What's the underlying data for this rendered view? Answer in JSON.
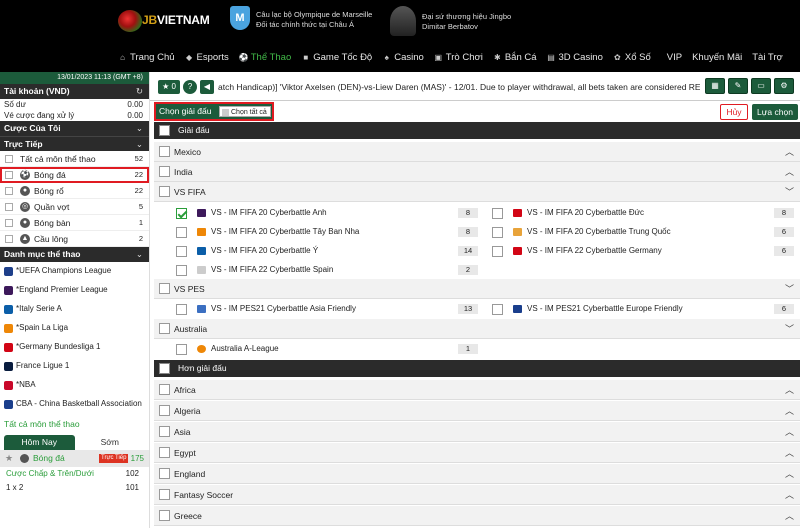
{
  "header": {
    "brand": "VIETNAM",
    "brand_prefix": "JB",
    "partner1": [
      "Câu lạc bộ Olympique de Marseille",
      "Đối tác chính thức tại Châu Á"
    ],
    "partner2": [
      "Đại sứ thương hiệu Jingbo",
      "Dimitar Berbatov"
    ],
    "nav": [
      {
        "label": "Trang Chủ",
        "icon": "home-icon"
      },
      {
        "label": "Esports",
        "icon": "gamepad-icon"
      },
      {
        "label": "Thể Thao",
        "icon": "soccer-ball-icon"
      },
      {
        "label": "Game Tốc Độ",
        "icon": "speed-icon"
      },
      {
        "label": "Casino",
        "icon": "cards-icon"
      },
      {
        "label": "Trò Chơi",
        "icon": "slot-icon"
      },
      {
        "label": "Bắn Cá",
        "icon": "fish-icon"
      },
      {
        "label": "3D Casino",
        "icon": "cube-icon"
      },
      {
        "label": "Xổ Số",
        "icon": "lottery-icon"
      },
      {
        "label": "VIP",
        "icon": ""
      },
      {
        "label": "Khuyến Mãi",
        "icon": ""
      },
      {
        "label": "Tài Trợ",
        "icon": ""
      }
    ]
  },
  "sidebar": {
    "datetime": "13/01/2023 11:13 (GMT +8)",
    "account_title": "Tài khoản (VND)",
    "balance_label": "Số dư",
    "balance_value": "0.00",
    "pending_label": "Vé cược đang xử lý",
    "pending_value": "0.00",
    "my_bets": "Cược Của Tôi",
    "live_title": "Trực Tiếp",
    "sports": [
      {
        "label": "Tất cả môn thể thao",
        "count": "52"
      },
      {
        "label": "Bóng đá",
        "count": "22"
      },
      {
        "label": "Bóng rổ",
        "count": "22"
      },
      {
        "label": "Quần vợt",
        "count": "5"
      },
      {
        "label": "Bóng bàn",
        "count": "1"
      },
      {
        "label": "Cầu lông",
        "count": "2"
      }
    ],
    "category_title": "Danh mục thể thao",
    "leagues": [
      {
        "label": "*UEFA Champions League"
      },
      {
        "label": "*England Premier League"
      },
      {
        "label": "*Italy Serie A"
      },
      {
        "label": "*Spain La Liga"
      },
      {
        "label": "*Germany Bundesliga 1"
      },
      {
        "label": "France Ligue 1"
      },
      {
        "label": "*NBA"
      },
      {
        "label": "CBA - China Basketball Association"
      }
    ],
    "all_sports_link": "Tất cả môn thể thao",
    "tab_today": "Hôm Nay",
    "tab_early": "Sớm",
    "football_label": "Bóng đá",
    "live_badge": "Trực Tiếp",
    "football_count": "175",
    "bet_types": [
      {
        "label": "Cược Chấp & Trên/Dưới",
        "count": "102"
      },
      {
        "label": "1 x 2",
        "count": "101"
      }
    ]
  },
  "toolbar": {
    "fav_count": "0",
    "help": "?",
    "marquee": "atch Handicap)] 'Viktor Axelsen (DEN)-vs-Liew Daren (MAS)' - 12/01. Due to player withdrawal, all bets taken are considered REFUNDE"
  },
  "selector": {
    "title": "Chọn giải đấu",
    "select_all": "Chọn tất cả",
    "cancel": "Hủy",
    "confirm": "Lựa chọn"
  },
  "leagues_group": "Giải đấu",
  "more_group": "Hơn giải đấu",
  "categories": {
    "mexico": "Mexico",
    "india": "India",
    "vs_fifa": "VS FIFA",
    "vs_pes": "VS PES",
    "australia": "Australia"
  },
  "fifa_left": [
    {
      "label": "VS - IM FIFA 20 Cyberbattle Anh",
      "count": "8"
    },
    {
      "label": "VS - IM FIFA 20 Cyberbattle Tây Ban Nha",
      "count": "8"
    },
    {
      "label": "VS - IM FIFA 20 Cyberbattle Ý",
      "count": "14"
    },
    {
      "label": "VS - IM FIFA 22 Cyberbattle Spain",
      "count": "2"
    }
  ],
  "fifa_right": [
    {
      "label": "VS - IM FIFA 20 Cyberbattle Đức",
      "count": "8"
    },
    {
      "label": "VS - IM FIFA 20 Cyberbattle Trung Quốc",
      "count": "6"
    },
    {
      "label": "VS - IM FIFA 22 Cyberbattle Germany",
      "count": "6"
    }
  ],
  "pes_left": {
    "label": "VS - IM PES21 Cyberbattle Asia Friendly",
    "count": "13"
  },
  "pes_right": {
    "label": "VS - IM PES21 Cyberbattle Europe Friendly",
    "count": "6"
  },
  "australia_league": {
    "label": "Australia A-League",
    "count": "1"
  },
  "more_list": [
    "Africa",
    "Algeria",
    "Asia",
    "Egypt",
    "England",
    "Fantasy Soccer",
    "Greece"
  ],
  "colors": {
    "brand_green": "#1c5b3b",
    "active_green": "#41b948",
    "highlight_red": "#e01b22",
    "dark": "#2b2b2b"
  }
}
